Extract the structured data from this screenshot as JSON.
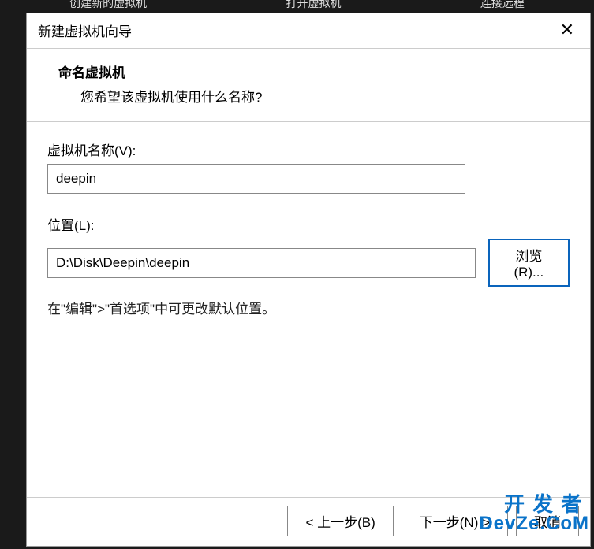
{
  "topbar": {
    "item1": "创建新的虚拟机",
    "item2": "打开虚拟机",
    "item3": "连接远程"
  },
  "dialog": {
    "title": "新建虚拟机向导",
    "header": {
      "title": "命名虚拟机",
      "subtitle": "您希望该虚拟机使用什么名称?"
    },
    "name_field": {
      "label": "虚拟机名称(V):",
      "value": "deepin"
    },
    "location_field": {
      "label": "位置(L):",
      "value": "D:\\Disk\\Deepin\\deepin",
      "browse_label": "浏览(R)..."
    },
    "hint": "在\"编辑\">\"首选项\"中可更改默认位置。",
    "footer": {
      "back": "< 上一步(B)",
      "next": "下一步(N) >",
      "cancel": "取消"
    }
  },
  "watermark": {
    "line1": "开发者",
    "line2": "DevZe.CoM"
  }
}
